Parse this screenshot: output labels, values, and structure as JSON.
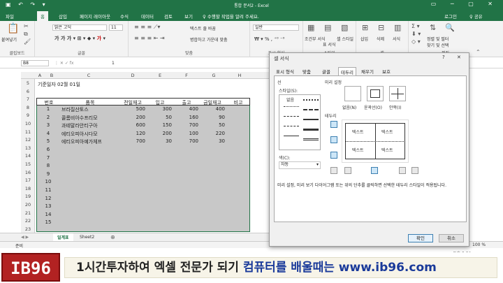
{
  "window": {
    "title": "통합 문서2 - Excel"
  },
  "tabs": [
    "파일",
    "홈",
    "삽입",
    "페이지 레이아웃",
    "수식",
    "데이터",
    "검토",
    "보기"
  ],
  "active_tab": "홈",
  "tell_me": "♀ 수행할 작업을 알려 주세요.",
  "account": {
    "login": "로그인",
    "share": "♀ 공유"
  },
  "ribbon": {
    "clipboard": "클립보드",
    "paste": "붙여넣기",
    "font_group": "글꼴",
    "font_name": "맑은 고딕",
    "font_size": "11",
    "align_group": "맞춤",
    "wrap_text": "텍스트 줄 바꿈",
    "merge": "병합하고 가운데 맞춤",
    "number_group": "표시 형식",
    "number_format": "일반",
    "styles": [
      "조건부 서식",
      "표 서식",
      "셀 스타일"
    ],
    "styles_group": "스타일",
    "cells": [
      "삽입",
      "삭제",
      "서식"
    ],
    "cells_group": "셀",
    "editing": [
      "정렬 및 필터",
      "찾기 및 선택"
    ],
    "editing_group": "편집"
  },
  "formula_bar": {
    "name_box": "B8",
    "value": "1"
  },
  "columns": [
    "A",
    "B",
    "C",
    "D",
    "E",
    "F",
    "G",
    "H"
  ],
  "rows": [
    "5",
    "6",
    "7",
    "8",
    "9",
    "10",
    "11",
    "12",
    "13",
    "14",
    "15",
    "16",
    "17",
    "18",
    "19",
    "20",
    "21",
    "22",
    "23",
    "24",
    "25",
    "26"
  ],
  "sheet": {
    "base_date": "기준일자 02월 01일",
    "headers": [
      "번호",
      "품목",
      "전일재고",
      "입고",
      "출고",
      "금일재고",
      "비고"
    ],
    "data": [
      [
        "1",
        "브라질산토스",
        "500",
        "300",
        "400",
        "400"
      ],
      [
        "2",
        "콜롬비아수프리모",
        "200",
        "50",
        "160",
        "90"
      ],
      [
        "3",
        "과테말라안티구아",
        "600",
        "150",
        "700",
        "50"
      ],
      [
        "4",
        "에티오피아시다모",
        "120",
        "200",
        "100",
        "220"
      ],
      [
        "5",
        "에티오피아예가체프",
        "700",
        "30",
        "700",
        "30"
      ]
    ],
    "empty_numbers": [
      "6",
      "7",
      "8",
      "9",
      "10",
      "11",
      "12",
      "13",
      "14",
      "15",
      "16"
    ]
  },
  "sheet_tabs": [
    "일계표",
    "Sheet2"
  ],
  "status": {
    "ready": "준비",
    "zoom": "100 %"
  },
  "taskbar_time": "오후 5:58",
  "dialog": {
    "title": "셀 서식",
    "help": "?",
    "close": "✕",
    "tabs": [
      "표시 형식",
      "맞춤",
      "글꼴",
      "테두리",
      "채우기",
      "보호"
    ],
    "selected_tab": "테두리",
    "line_label": "선",
    "style_label": "스타일(S):",
    "none_style": "없음",
    "color_label": "색(C):",
    "color_value": "자동",
    "presets_label": "미리 설정",
    "presets": [
      "없음(N)",
      "윤곽선(O)",
      "안쪽(I)"
    ],
    "border_label": "테두리",
    "preview_text": [
      "텍스트",
      "텍스트",
      "텍스트",
      "텍스트"
    ],
    "description": "미리 설정, 미리 보기 다이어그램 또는 위의 단추를 클릭하면 선택한 테두리 스타일이 적용됩니다.",
    "ok": "확인",
    "cancel": "취소"
  },
  "banner": {
    "logo": "IB96",
    "slogan_part1": "1시간투자하여 엑셀 전문가 되기 ",
    "slogan_part2": "컴퓨터를 배울때는 www.ib96.com"
  },
  "colors": {
    "excel_green": "#217346",
    "banner_red": "#b22222"
  }
}
